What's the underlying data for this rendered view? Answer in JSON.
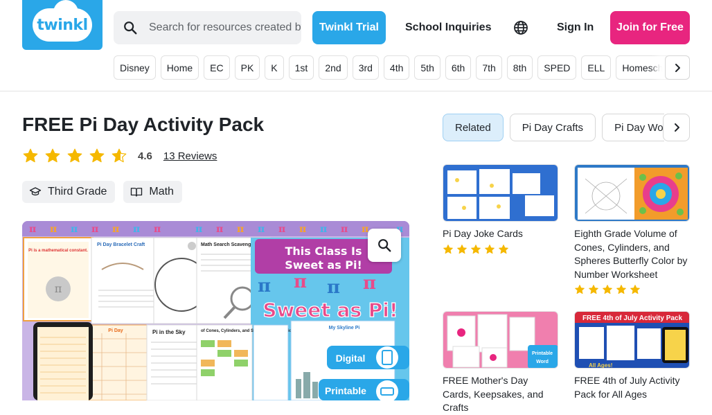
{
  "header": {
    "logo_text": "twinkl",
    "search_placeholder": "Search for resources created by teachers",
    "trial_label": "Twinkl Trial",
    "school_label": "School Inquiries",
    "sign_in_label": "Sign In",
    "join_label": "Join for Free"
  },
  "categories": [
    "Disney",
    "Home",
    "EC",
    "PK",
    "K",
    "1st",
    "2nd",
    "3rd",
    "4th",
    "5th",
    "6th",
    "7th",
    "8th",
    "SPED",
    "ELL",
    "Homeschool"
  ],
  "resource": {
    "title": "FREE Pi Day Activity Pack",
    "rating_value": "4.6",
    "rating_fraction": 0.92,
    "reviews_label": "13 Reviews",
    "tags": [
      {
        "label": "Third Grade",
        "icon": "graduation-cap-icon"
      },
      {
        "label": "Math",
        "icon": "book-icon"
      }
    ],
    "preview": {
      "bracelet_title": "Pi Day Bracelet Craft",
      "scavenger_title": "Math Search Scavenger Hunt",
      "banner_line1": "This Class Is",
      "banner_line2": "Sweet as Pi!",
      "sweet_text": "Sweet as Pi!",
      "pi_fact": "Pi is a mathematical constant.",
      "wordsearch_title": "Pi Day",
      "sky_title": "Pi in the Sky",
      "cones_title": "of Cones, Cylinders, and Spheres Mystery Picture",
      "skyline_title": "My Skyline Pi",
      "digital_label": "Digital",
      "printable_label": "Printable"
    }
  },
  "related": {
    "tabs": [
      "Related",
      "Pi Day Crafts",
      "Pi Day Worksheets"
    ],
    "cards": [
      {
        "title": "Pi Day Joke Cards",
        "stars": 5
      },
      {
        "title": "Eighth Grade Volume of Cones, Cylinders, and Spheres Butterfly Color by Number Worksheet",
        "stars": 5
      },
      {
        "title": "FREE Mother's Day Cards, Keepsakes, and Crafts",
        "stars": 0
      },
      {
        "title": "FREE 4th of July Activity Pack for All Ages",
        "stars": 0
      }
    ],
    "card_labels": {
      "printable": "Printable",
      "word": "Word",
      "fourth_banner": "FREE 4th of July Activity Pack",
      "all_ages": "All Ages!"
    }
  },
  "colors": {
    "brand_blue": "#2aa7e8",
    "join_pink": "#e8257f",
    "star": "#f5b800",
    "active_tab": "#dceefb"
  }
}
